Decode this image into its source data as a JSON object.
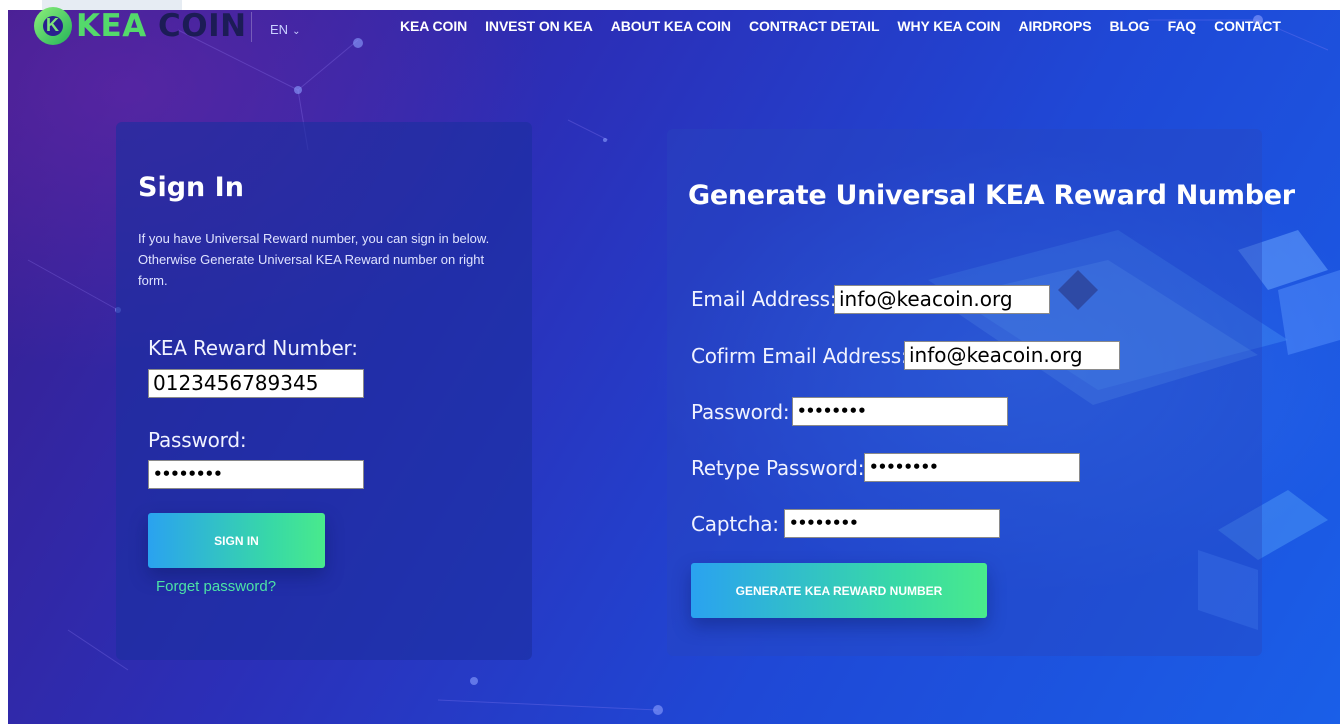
{
  "brand": {
    "logo_text_a": "KEA",
    "logo_text_b": " COIN"
  },
  "header": {
    "language": "EN",
    "nav": [
      "KEA COIN",
      "INVEST ON KEA",
      "ABOUT KEA COIN",
      "CONTRACT DETAIL",
      "WHY KEA COIN",
      "AIRDROPS",
      "BLOG",
      "FAQ",
      "CONTACT"
    ]
  },
  "signin": {
    "title": "Sign In",
    "description": "If you have Universal Reward number, you can sign in below. Otherwise Generate Universal KEA Reward number on right form.",
    "reward_label": "KEA Reward Number:",
    "reward_value": "0123456789345",
    "password_label": "Password:",
    "password_value": "••••••••",
    "button": "SIGN IN",
    "forgot": "Forget password?"
  },
  "generate": {
    "title": "Generate Universal KEA Reward Number",
    "email_label": "Email Address:",
    "email_value": "info@keacoin.org",
    "confirm_label": "Cofirm Email Address:",
    "confirm_value": "info@keacoin.org",
    "password_label": "Password:",
    "password_value": "••••••••",
    "retype_label": "Retype Password:",
    "retype_value": "••••••••",
    "captcha_label": "Captcha:",
    "captcha_value": "••••••••",
    "button": "GENERATE KEA REWARD NUMBER"
  },
  "colors": {
    "accent_green": "#4ce2a6",
    "button_start": "#2aa2f0",
    "button_end": "#49ea8c"
  }
}
